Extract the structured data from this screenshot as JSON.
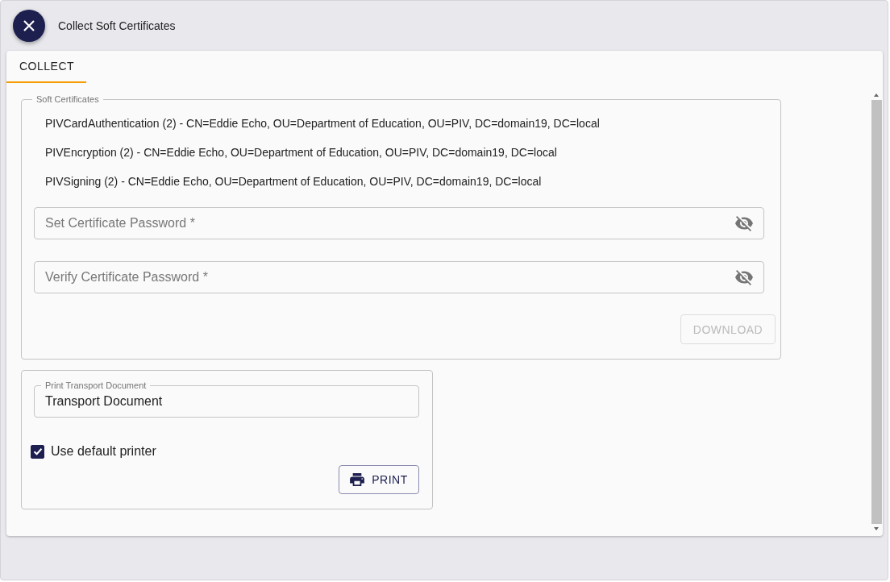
{
  "dialog": {
    "title": "Collect Soft Certificates"
  },
  "tabs": [
    {
      "label": "COLLECT",
      "selected": true
    }
  ],
  "soft_certificates": {
    "legend": "Soft Certificates",
    "certificates": [
      "PIVCardAuthentication (2) - CN=Eddie Echo, OU=Department of Education, OU=PIV, DC=domain19, DC=local",
      "PIVEncryption (2) - CN=Eddie Echo, OU=Department of Education, OU=PIV, DC=domain19, DC=local",
      "PIVSigning (2) - CN=Eddie Echo, OU=Department of Education, OU=PIV, DC=domain19, DC=local"
    ],
    "password_fields": [
      {
        "placeholder": "Set Certificate Password *"
      },
      {
        "placeholder": "Verify Certificate Password *"
      }
    ],
    "download_button": {
      "label": "DOWNLOAD",
      "disabled": true
    }
  },
  "print_transport": {
    "field_label": "Print Transport Document",
    "value": "Transport Document",
    "default_printer": {
      "label": "Use default printer",
      "checked": true
    },
    "print_button": {
      "label": "PRINT"
    }
  }
}
